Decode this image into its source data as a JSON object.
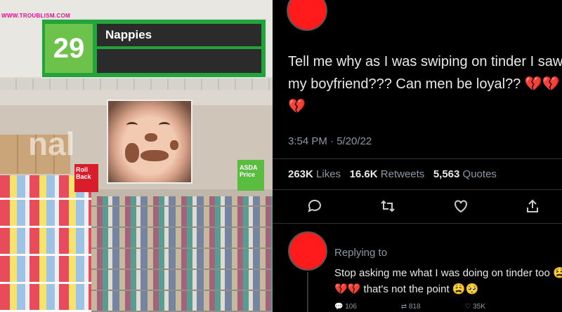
{
  "photo": {
    "watermark": "WWW.TROUBLISM.COM",
    "aisle_number": "29",
    "aisle_label": "Nappies",
    "background_letters": "nal",
    "red_sign_text": "Roll Back",
    "asda_sign_text": "ASDA Price"
  },
  "tweet": {
    "text": "Tell me why as I was swiping on tinder I saw my boyfriend??? Can men be loyal??",
    "text_emoji": "💔💔💔",
    "time": "3:54 PM · 5/20/22",
    "likes_count": "263K",
    "likes_label": "Likes",
    "retweets_count": "16.6K",
    "retweets_label": "Retweets",
    "quotes_count": "5,563",
    "quotes_label": "Quotes",
    "icons": [
      "comment-icon",
      "retweet-icon",
      "heart-icon",
      "share-icon"
    ],
    "avatar_color": "#ff1b1b"
  },
  "reply": {
    "replying_label": "Replying to",
    "text": "Stop asking me what I was doing on tinder too",
    "text_emoji": "😫💔💔",
    "text_end": "that's not the point",
    "text_end_emoji": "😩🥺",
    "reply_count": "106",
    "retweet_count": "818",
    "like_count": "35K"
  }
}
